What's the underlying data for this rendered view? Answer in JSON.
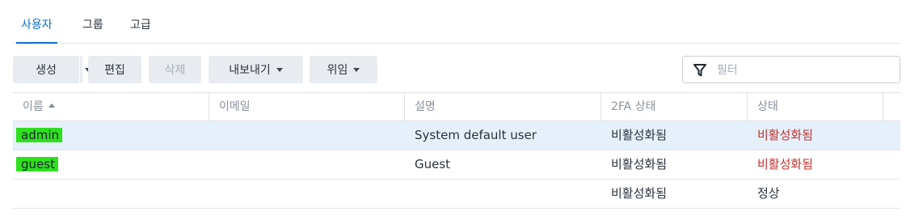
{
  "tabs": [
    {
      "label": "사용자",
      "active": true
    },
    {
      "label": "그룹",
      "active": false
    },
    {
      "label": "고급",
      "active": false
    }
  ],
  "toolbar": {
    "create": "생성",
    "edit": "편집",
    "delete": "삭제",
    "export": "내보내기",
    "delegate": "위임",
    "filter_placeholder": "필터"
  },
  "table": {
    "columns": [
      "이름",
      "이메일",
      "설명",
      "2FA 상태",
      "상태"
    ],
    "rows": [
      {
        "name": "admin",
        "email": "",
        "description": "System default user",
        "twofa": "비활성화됨",
        "status": "비활성화됨",
        "status_type": "disabled",
        "selected": true
      },
      {
        "name": "guest",
        "email": "",
        "description": "Guest",
        "twofa": "비활성화됨",
        "status": "비활성화됨",
        "status_type": "disabled",
        "selected": false
      },
      {
        "name": "",
        "email": "",
        "description": "",
        "twofa": "비활성화됨",
        "status": "정상",
        "status_type": "normal",
        "selected": false
      }
    ]
  },
  "colors": {
    "accent": "#0e6fc7",
    "disabled_status": "#c2322e",
    "highlight": "#2ee01e",
    "selected_row": "#e6f0fb"
  }
}
